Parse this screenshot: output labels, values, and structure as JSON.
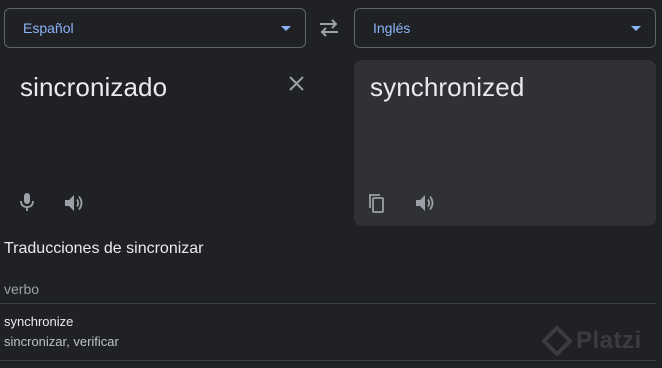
{
  "source_language": {
    "label": "Español"
  },
  "target_language": {
    "label": "Inglés"
  },
  "source": {
    "text": "sincronizado"
  },
  "target": {
    "text": "synchronized"
  },
  "dictionary": {
    "heading": "Traducciones de sincronizar",
    "part_of_speech": "verbo",
    "entries": [
      {
        "word": "synchronize",
        "translations": "sincronizar, verificar"
      }
    ]
  },
  "watermark": {
    "text": "Platzi"
  },
  "colors": {
    "background": "#202124",
    "panel": "#303134",
    "accent": "#8ab4f8",
    "icon": "#9aa0a6",
    "divider": "#3c4043"
  },
  "icons": [
    "chevron-down-icon",
    "swap-icon",
    "close-icon",
    "microphone-icon",
    "speaker-icon",
    "copy-icon"
  ]
}
